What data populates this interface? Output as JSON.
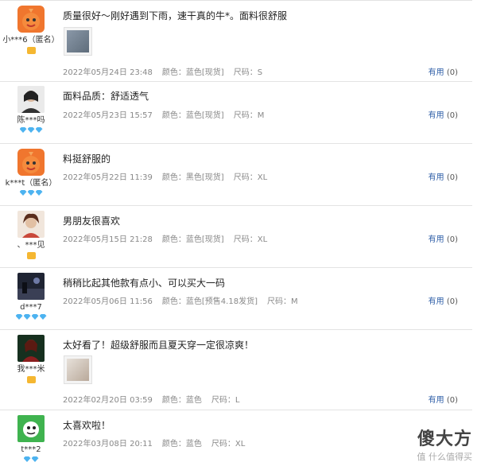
{
  "reviews": [
    {
      "user": "小***6（匿名）",
      "level": "crown",
      "text": "质量很好～刚好遇到下雨，速干真的牛*。面料很舒服",
      "date": "2022年05月24日 23:48",
      "color": "颜色：蓝色[现货]",
      "size": "尺码：S",
      "useful": "有用",
      "count": "(0)",
      "avatar_icon": "orange-mascot-icon",
      "has_image": true
    },
    {
      "user": "陈***吗",
      "level": "diamond3",
      "text": "面料品质：舒适透气",
      "date": "2022年05月23日 15:57",
      "color": "颜色：蓝色[现货]",
      "size": "尺码：M",
      "useful": "有用",
      "count": "(0)",
      "avatar_icon": "portrait-avatar-icon",
      "has_image": false
    },
    {
      "user": "k***t（匿名）",
      "level": "diamond3",
      "text": "料挺舒服的",
      "date": "2022年05月22日 11:39",
      "color": "颜色：黑色[现货]",
      "size": "尺码：XL",
      "useful": "有用",
      "count": "(0)",
      "avatar_icon": "orange-mascot-icon",
      "has_image": false
    },
    {
      "user": "、***见",
      "level": "crown",
      "text": "男朋友很喜欢",
      "date": "2022年05月15日 21:28",
      "color": "颜色：蓝色[现货]",
      "size": "尺码：XL",
      "useful": "有用",
      "count": "(0)",
      "avatar_icon": "portrait-avatar-icon",
      "has_image": false
    },
    {
      "user": "d***7",
      "level": "diamond4",
      "text": "稍稍比起其他款有点小、可以买大一码",
      "date": "2022年05月06日 11:56",
      "color": "颜色：蓝色[预售4.18发货]",
      "size": "尺码：M",
      "useful": "有用",
      "count": "(0)",
      "avatar_icon": "photo-avatar-icon",
      "has_image": false
    },
    {
      "user": "我***米",
      "level": "crown",
      "text": "太好看了！超级舒服而且夏天穿一定很凉爽！",
      "date": "2022年02月20日 03:59",
      "color": "颜色：蓝色",
      "size": "尺码：L",
      "useful": "有用",
      "count": "(0)",
      "avatar_icon": "photo-avatar-icon",
      "has_image": true
    },
    {
      "user": "t***2",
      "level": "diamond2",
      "text": "太喜欢啦！",
      "date": "2022年03月08日 20:11",
      "color": "颜色：蓝色",
      "size": "尺码：XL",
      "useful": "",
      "count": "",
      "avatar_icon": "green-cartoon-avatar-icon",
      "has_image": false
    }
  ],
  "watermark": {
    "big": "傻大方",
    "small": "值 什么值得买"
  }
}
